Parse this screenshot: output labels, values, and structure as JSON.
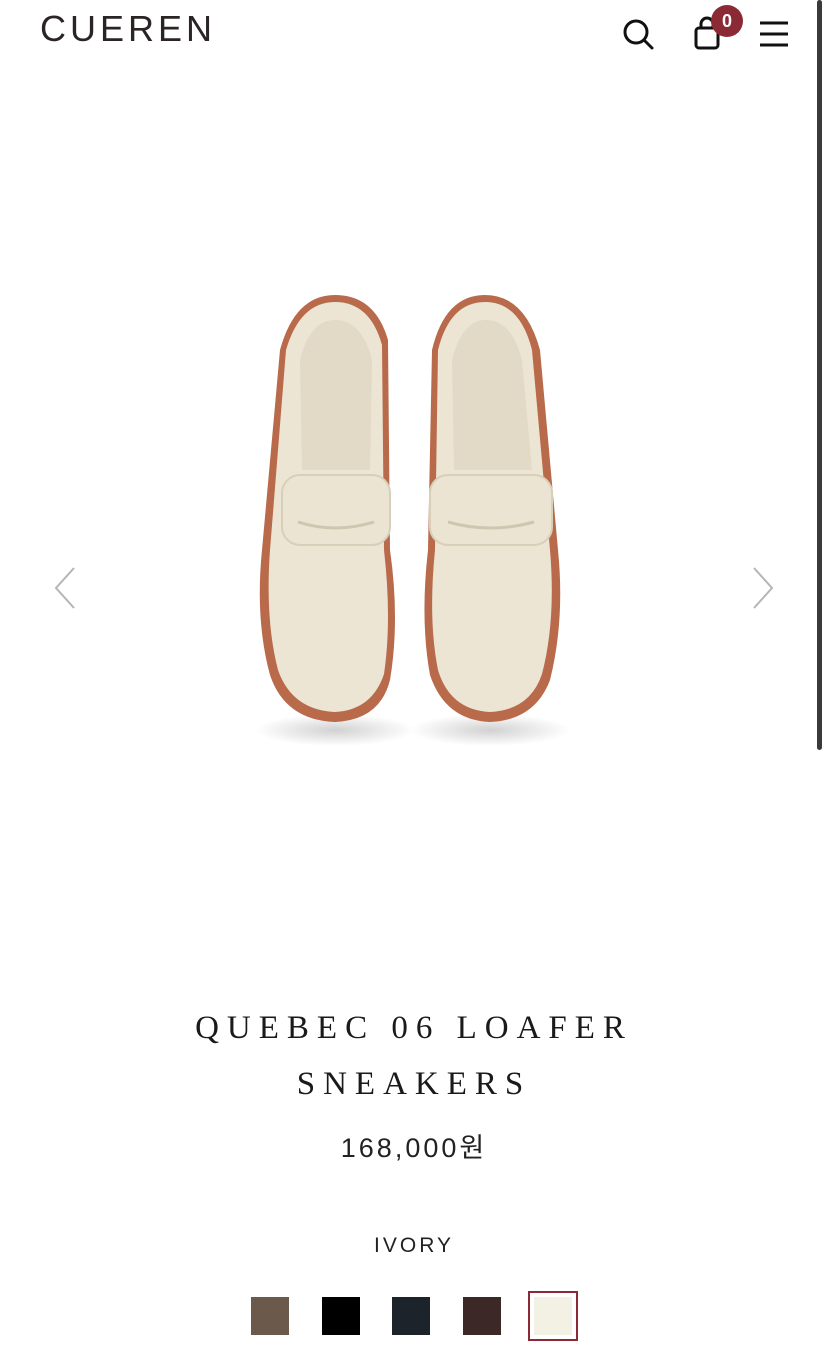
{
  "header": {
    "logo": "CUEREN",
    "search_icon": "search-icon",
    "cart_icon": "shopping-bag-icon",
    "cart_count": "0",
    "menu_icon": "hamburger-menu-icon",
    "badge_color": "#8b2a35"
  },
  "gallery": {
    "image_alt": "shoes-product-image",
    "prev_icon": "chevron-left-icon",
    "next_icon": "chevron-right-icon"
  },
  "product": {
    "title_line1": "QUEBEC 06 LOAFER",
    "title_line2": "SNEAKERS",
    "price": "168,000원",
    "selected_color": "IVORY"
  },
  "swatches": [
    {
      "color": "#6b5a4c",
      "selected": false
    },
    {
      "color": "#000000",
      "selected": false
    },
    {
      "color": "#1d232b",
      "selected": false
    },
    {
      "color": "#3c2827",
      "selected": false
    },
    {
      "color": "#f3f1e4",
      "selected": true
    }
  ]
}
